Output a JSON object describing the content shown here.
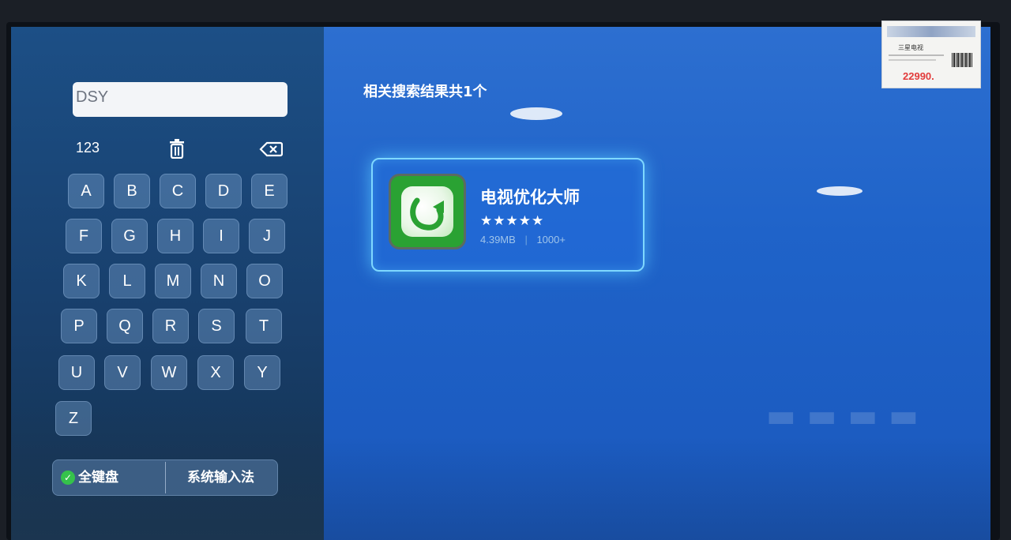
{
  "search": {
    "value": "DSY"
  },
  "keyboard": {
    "numeric_toggle": "123",
    "keys_row1": [
      "A",
      "B",
      "C",
      "D",
      "E"
    ],
    "keys_row2": [
      "F",
      "G",
      "H",
      "I",
      "J"
    ],
    "keys_row3": [
      "K",
      "L",
      "M",
      "N",
      "O"
    ],
    "keys_row4": [
      "P",
      "Q",
      "R",
      "S",
      "T"
    ],
    "keys_row5": [
      "U",
      "V",
      "W",
      "X",
      "Y"
    ],
    "keys_row6": [
      "Z"
    ],
    "icons": {
      "clear": "trash-icon",
      "backspace": "backspace-icon"
    }
  },
  "input_modes": {
    "full_keyboard": "全键盘",
    "system_input": "系统输入法",
    "selected_icon": "check-icon"
  },
  "results": {
    "header": "相关搜索结果共1个",
    "app": {
      "name": "电视优化大师",
      "rating_stars": "★★★★★",
      "size": "4.39MB",
      "downloads": "1000+",
      "icon": "tv-optimizer-app-icon"
    }
  },
  "price_tag": {
    "product": "三星电视",
    "price": "22990."
  },
  "colors": {
    "screen_blue": "#1f63c9",
    "card_border": "#7fd8ff",
    "app_green": "#2aa233",
    "price_red": "#e23b3b"
  }
}
